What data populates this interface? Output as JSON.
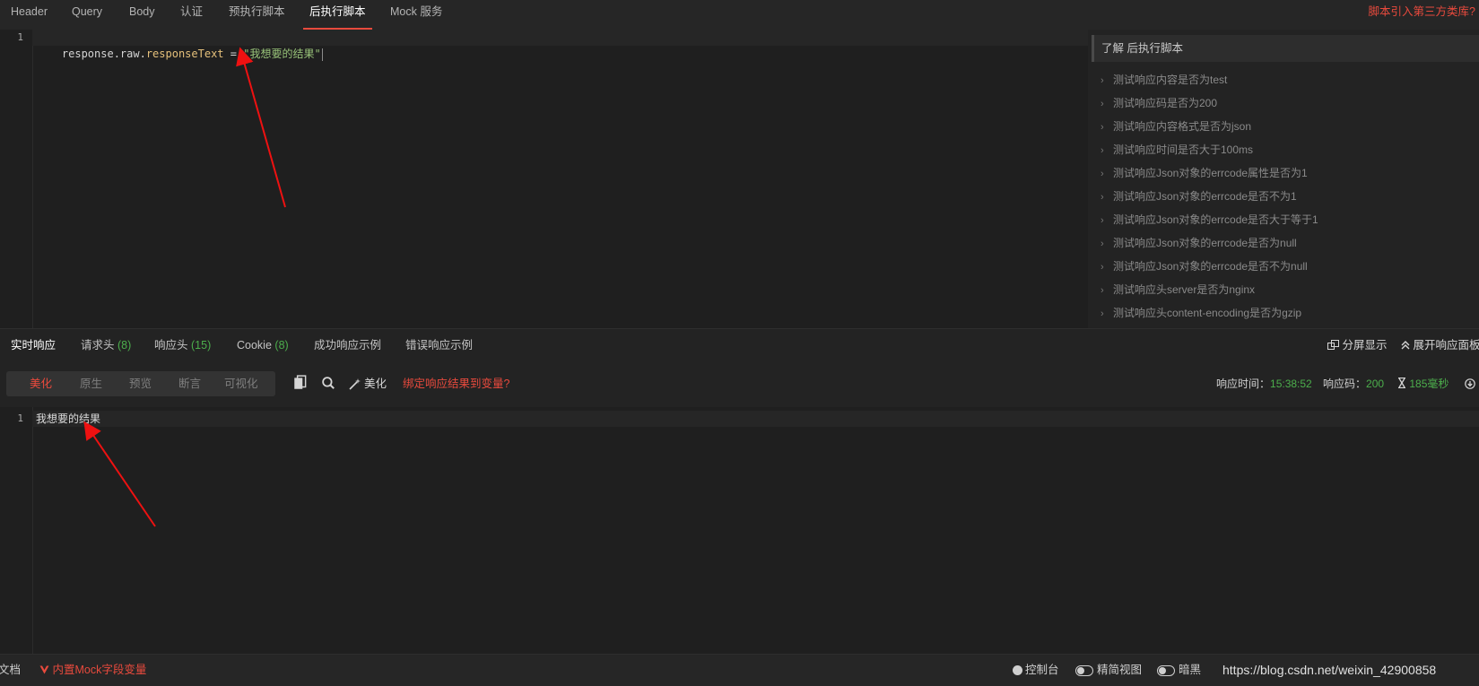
{
  "top_tabs": {
    "header": "Header",
    "query": "Query",
    "body": "Body",
    "auth": "认证",
    "pre_script": "预执行脚本",
    "post_script": "后执行脚本",
    "mock": "Mock 服务",
    "third_party_lib": "脚本引入第三方类库?"
  },
  "editor": {
    "line_number": "1",
    "code": {
      "obj": "response.raw.",
      "prop": "responseText",
      "op": " = ",
      "str": "\"我想要的结果\""
    }
  },
  "snippets": {
    "header": "了解 后执行脚本",
    "items": [
      "测试响应内容是否为test",
      "测试响应码是否为200",
      "测试响应内容格式是否为json",
      "测试响应时间是否大于100ms",
      "测试响应Json对象的errcode属性是否为1",
      "测试响应Json对象的errcode是否不为1",
      "测试响应Json对象的errcode是否大于等于1",
      "测试响应Json对象的errcode是否为null",
      "测试响应Json对象的errcode是否不为null",
      "测试响应头server是否为nginx",
      "测试响应头content-encoding是否为gzip"
    ]
  },
  "response_tabs": {
    "realtime": "实时响应",
    "req_headers": "请求头",
    "req_headers_count": "(8)",
    "resp_headers": "响应头",
    "resp_headers_count": "(15)",
    "cookie": "Cookie",
    "cookie_count": "(8)",
    "success_example": "成功响应示例",
    "error_example": "错误响应示例",
    "split_view": "分屏显示",
    "expand_panel": "展开响应面板"
  },
  "toolbar": {
    "modes": [
      "美化",
      "原生",
      "预览",
      "断言",
      "可视化"
    ],
    "beautify": "美化",
    "bind_var": "绑定响应结果到变量?",
    "resp_time_label": "响应时间：",
    "resp_time_value": "15:38:52",
    "status_label": "响应码：",
    "status_value": "200",
    "duration": "185毫秒"
  },
  "response_body": {
    "line_number": "1",
    "text": "我想要的结果"
  },
  "statusbar": {
    "docs": "文档",
    "mock_vars": "内置Mock字段变量",
    "console": "控制台",
    "compact_view": "精简视图",
    "dark": "暗黑",
    "watermark": "https://blog.csdn.net/weixin_42900858"
  },
  "colors": {
    "accent": "#e84a3d",
    "success": "#4cae4c",
    "background": "#232323"
  }
}
